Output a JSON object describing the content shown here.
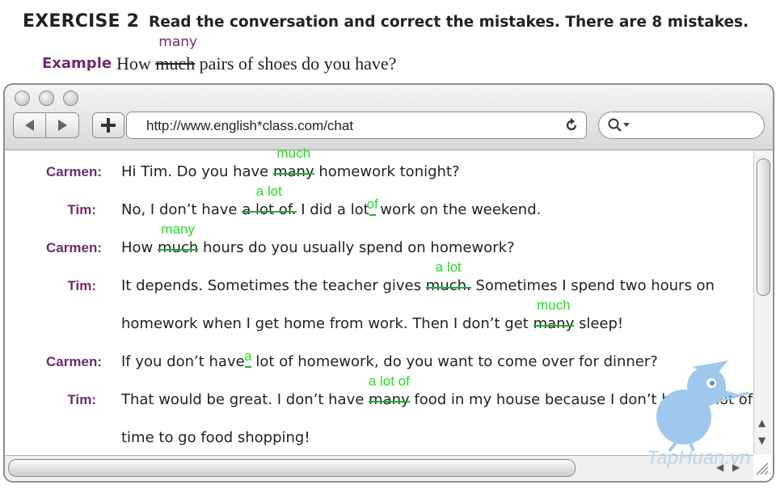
{
  "header": {
    "exercise": "EXERCISE 2",
    "instruction": "Read the conversation and correct the mistakes. There are 8 mistakes."
  },
  "example": {
    "label": "Example",
    "before": "How ",
    "wrong": "much",
    "correction": "many",
    "after": " pairs of shoes do you have?"
  },
  "browser": {
    "url": "http://www.english*class.com/chat"
  },
  "conversation": [
    {
      "speaker": "Carmen:",
      "text": "Hi Tim. Do you have ",
      "wrong": "many",
      "fix": "much",
      "after": " homework tonight?"
    },
    {
      "speaker": "Tim:",
      "text": "No, I don’t have ",
      "wrong": "a lot of.",
      "fix": "a lot",
      "mid": " I did a lot",
      "fix2": "of",
      "after": " work on the weekend."
    },
    {
      "speaker": "Carmen:",
      "text": "How ",
      "wrong": "much",
      "fix": "many",
      "after": " hours do you usually spend on homework?"
    },
    {
      "speaker": "Tim:",
      "text": "It depends. Sometimes the teacher gives ",
      "wrong": "much.",
      "fix": "a lot",
      "after": " Sometimes I spend two hours on"
    },
    {
      "text": "homework when I get home from work. Then I don’t get ",
      "wrong": "many",
      "fix": "much",
      "after": " sleep!"
    },
    {
      "speaker": "Carmen:",
      "text": "If you don’t have",
      "fix": "a",
      "after": " lot of homework, do you want to come over for dinner?"
    },
    {
      "speaker": "Tim:",
      "text": "That would be great. I don’t have ",
      "wrong": "many",
      "fix": "a lot of",
      "after": " food in my house because I don’t have a lot of"
    },
    {
      "text": "time to go food shopping!"
    }
  ],
  "watermark": "TapHuan.vn"
}
